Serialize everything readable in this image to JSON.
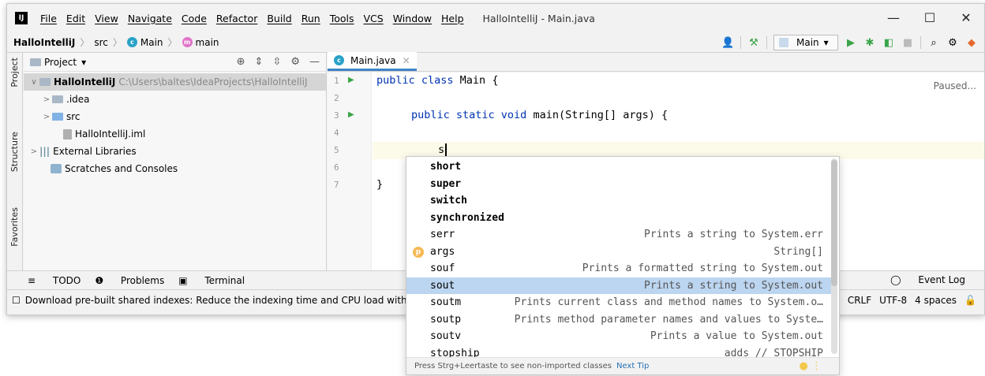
{
  "window": {
    "title": "HalloIntelliJ - Main.java",
    "logo": "IJ",
    "menu": [
      "File",
      "Edit",
      "View",
      "Navigate",
      "Code",
      "Refactor",
      "Build",
      "Run",
      "Tools",
      "VCS",
      "Window",
      "Help"
    ],
    "controls": {
      "minimize": "—",
      "maximize": "☐",
      "close": "✕"
    }
  },
  "navbar": {
    "project": "HalloIntelliJ",
    "src": "src",
    "class": "Main",
    "method": "main",
    "run_config": "Main"
  },
  "project_panel": {
    "title": "Project",
    "tree": [
      {
        "label": "HalloIntelliJ",
        "path": "C:\\Users\\baltes\\IdeaProjects\\HalloIntelliJ",
        "arrow": "∨",
        "selected": true
      },
      {
        "label": ".idea",
        "arrow": ">"
      },
      {
        "label": "src",
        "arrow": ">"
      },
      {
        "label": "HalloIntelliJ.iml",
        "arrow": ""
      },
      {
        "label": "External Libraries",
        "arrow": ">"
      },
      {
        "label": "Scratches and Consoles",
        "arrow": ""
      }
    ]
  },
  "stripe": {
    "project": "Project",
    "structure": "Structure",
    "favorites": "Favorites"
  },
  "editor": {
    "tab": "Main.java",
    "status": "Paused...",
    "lines": [
      "1",
      "2",
      "3",
      "4",
      "5",
      "6",
      "7"
    ],
    "code": {
      "l1_kw": "public class",
      "l1_rest": " Main {",
      "l3_kw": "public static void",
      "l3_rest": " main(String[] args) {",
      "l4": "s",
      "l5": "}",
      "l6": "}"
    }
  },
  "completion": {
    "items": [
      {
        "name": "short",
        "desc": "",
        "bold": true
      },
      {
        "name": "super",
        "desc": "",
        "bold": true
      },
      {
        "name": "switch",
        "desc": "",
        "bold": true
      },
      {
        "name": "synchronized",
        "desc": "",
        "bold": true
      },
      {
        "name": "serr",
        "desc": "Prints a string to System.err"
      },
      {
        "name": "args",
        "desc": "String[]",
        "icon": "p"
      },
      {
        "name": "souf",
        "desc": "Prints a formatted string to System.out"
      },
      {
        "name": "sout",
        "desc": "Prints a string to System.out",
        "selected": true
      },
      {
        "name": "soutm",
        "desc": "Prints current class and method names to System.o…"
      },
      {
        "name": "soutp",
        "desc": "Prints method parameter names and values to Syste…"
      },
      {
        "name": "soutv",
        "desc": "Prints a value to System.out"
      },
      {
        "name": "stopship",
        "desc": "adds // STOPSHIP"
      }
    ],
    "footer": "Press Strg+Leertaste to see non-imported classes",
    "footer_link": "Next Tip"
  },
  "bottom": {
    "todo": "TODO",
    "problems": "Problems",
    "terminal": "Terminal",
    "event_log": "Event Log"
  },
  "status": {
    "message": "Download pre-built shared indexes: Reduce the indexing time and CPU load with p",
    "line_sep": "CRLF",
    "encoding": "UTF-8",
    "indent": "4 spaces"
  }
}
